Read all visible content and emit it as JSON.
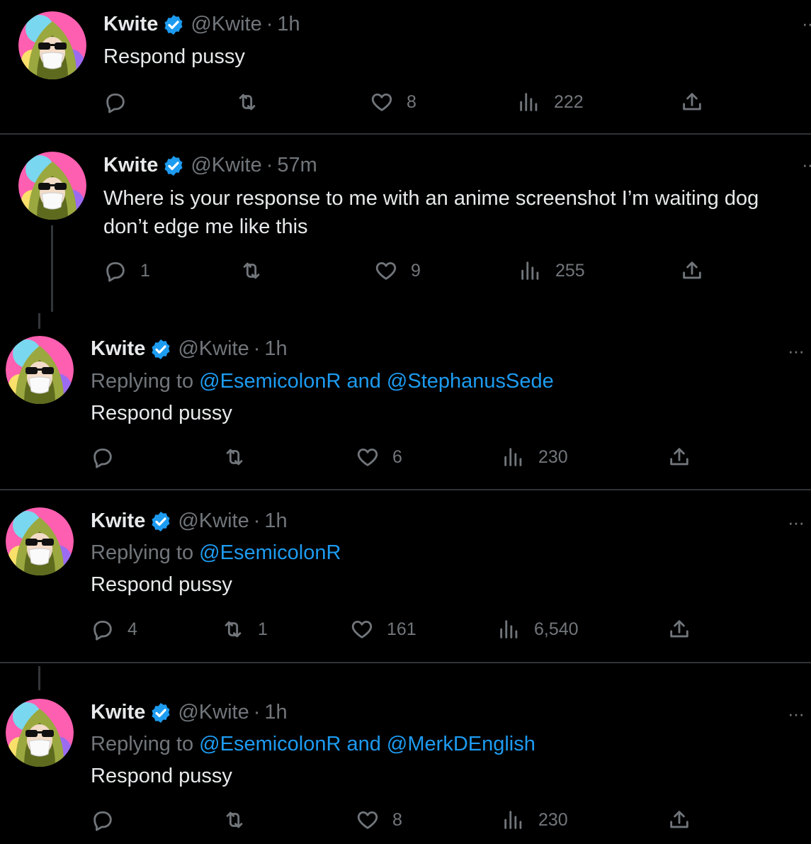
{
  "tweets": [
    {
      "name": "Kwite",
      "handle": "@Kwite",
      "sep": "·",
      "time": "1h",
      "body": "Respond pussy",
      "replies": "",
      "retweets": "",
      "likes": "8",
      "views": "222"
    },
    {
      "name": "Kwite",
      "handle": "@Kwite",
      "sep": "·",
      "time": "57m",
      "body": "Where is your response to me with an anime screenshot I’m waiting dog don’t edge me like this",
      "replies": "1",
      "retweets": "",
      "likes": "9",
      "views": "255"
    },
    {
      "name": "Kwite",
      "handle": "@Kwite",
      "sep": "·",
      "time": "1h",
      "replying_prefix": "Replying to ",
      "replying_links": "@EsemicolonR and @StephanusSede",
      "body": "Respond pussy",
      "replies": "",
      "retweets": "",
      "likes": "6",
      "views": "230"
    },
    {
      "name": "Kwite",
      "handle": "@Kwite",
      "sep": "·",
      "time": "1h",
      "replying_prefix": "Replying to ",
      "replying_links": "@EsemicolonR",
      "body": "Respond pussy",
      "replies": "4",
      "retweets": "1",
      "likes": "161",
      "views": "6,540"
    },
    {
      "name": "Kwite",
      "handle": "@Kwite",
      "sep": "·",
      "time": "1h",
      "replying_prefix": "Replying to ",
      "replying_links": "@EsemicolonR and @MerkDEnglish",
      "body": "Respond pussy",
      "replies": "",
      "retweets": "",
      "likes": "8",
      "views": "230"
    }
  ],
  "more_glyph": "···",
  "icons": {
    "reply": "reply-icon",
    "retweet": "retweet-icon",
    "like": "heart-icon",
    "views": "views-icon",
    "share": "share-icon",
    "verified": "verified-badge-icon"
  },
  "colors": {
    "background": "#000000",
    "text": "#e7e9ea",
    "muted": "#71767b",
    "link": "#1d9bf0",
    "verified": "#1d9bf0"
  }
}
